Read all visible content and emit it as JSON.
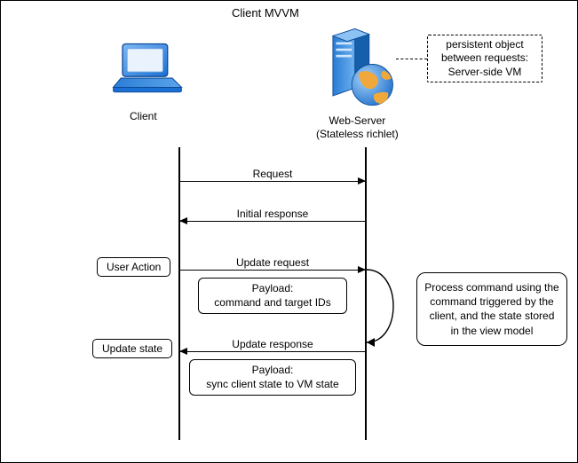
{
  "title": "Client MVVM",
  "actors": {
    "client": "Client",
    "server_line1": "Web-Server",
    "server_line2": "(Stateless richlet)"
  },
  "persistent_note": "persistent object between requests: Server-side VM",
  "events": {
    "user_action": "User Action",
    "update_state": "Update state"
  },
  "messages": {
    "request": "Request",
    "initial_response": "Initial response",
    "update_request": "Update request",
    "update_response": "Update response"
  },
  "payloads": {
    "p1_line1": "Payload:",
    "p1_line2": "command and target IDs",
    "p2_line1": "Payload:",
    "p2_line2": "sync client state to VM state"
  },
  "process": "Process command using the command triggered by the client, and the state stored in the view model",
  "chart_data": {
    "type": "sequence-diagram",
    "title": "Client MVVM",
    "participants": [
      {
        "id": "client",
        "label": "Client"
      },
      {
        "id": "server",
        "label": "Web-Server (Stateless richlet)"
      }
    ],
    "notes": [
      {
        "attached_to": "server",
        "text": "persistent object between requests: Server-side VM",
        "style": "dashed"
      }
    ],
    "interactions": [
      {
        "from": "client",
        "to": "server",
        "label": "Request"
      },
      {
        "from": "server",
        "to": "client",
        "label": "Initial response"
      },
      {
        "event_at": "client",
        "label": "User Action"
      },
      {
        "from": "client",
        "to": "server",
        "label": "Update request",
        "payload": "Payload: command and target IDs"
      },
      {
        "self_at": "server",
        "label": "Process command using the command triggered by the client, and the state stored in the view model"
      },
      {
        "from": "server",
        "to": "client",
        "label": "Update response",
        "payload": "Payload: sync client state to VM state"
      },
      {
        "event_at": "client",
        "label": "Update state"
      }
    ]
  }
}
